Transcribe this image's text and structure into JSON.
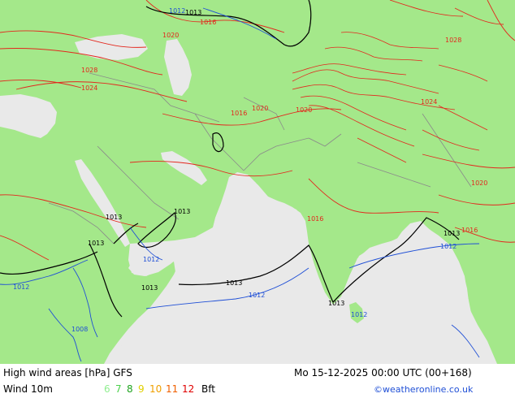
{
  "map": {
    "colors": {
      "land": "#a4e88a",
      "sea": "#e9e9e9",
      "isobar_high": "#e3271d",
      "isobar_low": "#1f4fd6",
      "isobar_neutral": "#000000",
      "border": "#8a8a8a"
    },
    "isobar_labels": {
      "l1012_top": "1012",
      "l1013_top": "1013",
      "l1016_n": "1016",
      "l1020_nw": "1020",
      "l1024_w": "1024",
      "l1028_nw": "1028",
      "l1020_c": "1020",
      "l1016_c": "1016",
      "l1013_arab": "1013",
      "l1013_oman": "1013",
      "l1012_yem": "1012",
      "l1013_horn": "1013",
      "l1013_somalia": "1013",
      "l1012_afr": "1012",
      "l1008_afr": "1008",
      "l1013_ind_ocean": "1013",
      "l1012_ind_ocean": "1012",
      "l1013_india": "1013",
      "l1013_bay": "1013",
      "l1012_bay": "1012",
      "l1012_sri": "1012",
      "l1016_india": "1016",
      "l1020_tibet": "1020",
      "l1024_tibet": "1024",
      "l1028_tibet": "1028",
      "l1016_se": "1016",
      "l1020_se": "1020"
    }
  },
  "footer": {
    "title": "High wind areas [hPa] GFS",
    "wind_label": "Wind 10m",
    "datetime": "Mo 15-12-2025 00:00 UTC (00+168)",
    "bft_unit": "Bft",
    "credit": "©weatheronline.co.uk",
    "bft_scale": [
      {
        "value": "6",
        "color": "#90ee90"
      },
      {
        "value": "7",
        "color": "#4bd14b"
      },
      {
        "value": "8",
        "color": "#1ea31e"
      },
      {
        "value": "9",
        "color": "#e0d000"
      },
      {
        "value": "10",
        "color": "#f0a000"
      },
      {
        "value": "11",
        "color": "#f06000"
      },
      {
        "value": "12",
        "color": "#e00000"
      }
    ]
  }
}
